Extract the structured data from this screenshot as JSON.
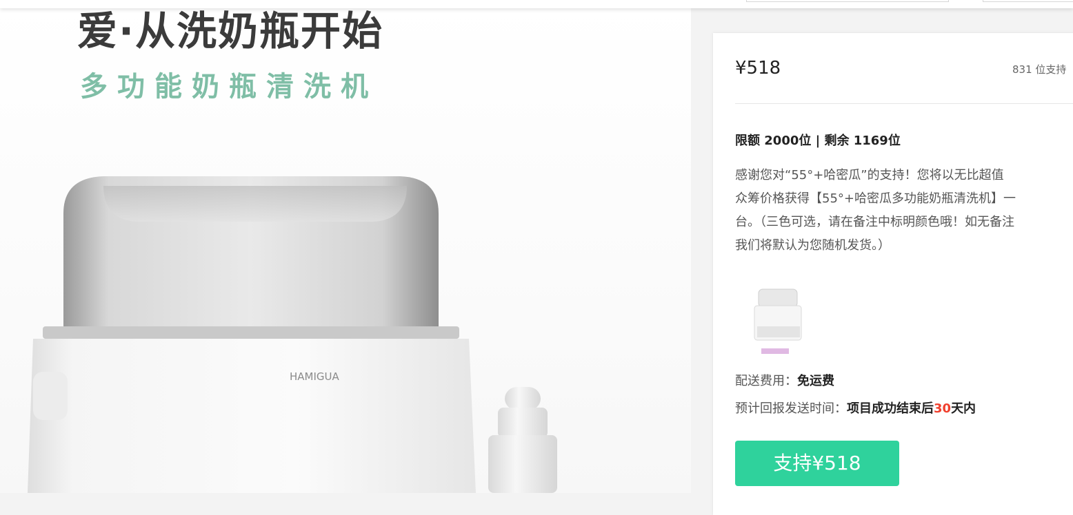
{
  "banner": {
    "headline": "爱·从洗奶瓶开始",
    "subheadline": "多功能奶瓶清洗机",
    "brand_mark": "HAMIGUA"
  },
  "reward": {
    "price": "¥518",
    "backers": "831 位支持",
    "limit_text": "限额 2000位 | 剩余 1169位",
    "description_lines": [
      "感谢您对“55°+哈密瓜”的支持！您将以无比超值",
      "众筹价格获得【55°+哈密瓜多功能奶瓶清洗机】一",
      "台。（三色可选，请在备注中标明颜色哦！如无备注",
      "我们将默认为您随机发货。）"
    ],
    "shipping_label": "配送费用：",
    "shipping_value": "免运费",
    "eta_label": "预计回报发送时间：",
    "eta_prefix": "项目成功结束后",
    "eta_days": "30",
    "eta_suffix": "天内",
    "support_button": "支持¥518"
  },
  "colors": {
    "accent_green": "#2fd29c",
    "subtitle_green": "#7fbea6",
    "highlight_red": "#f0402e"
  }
}
